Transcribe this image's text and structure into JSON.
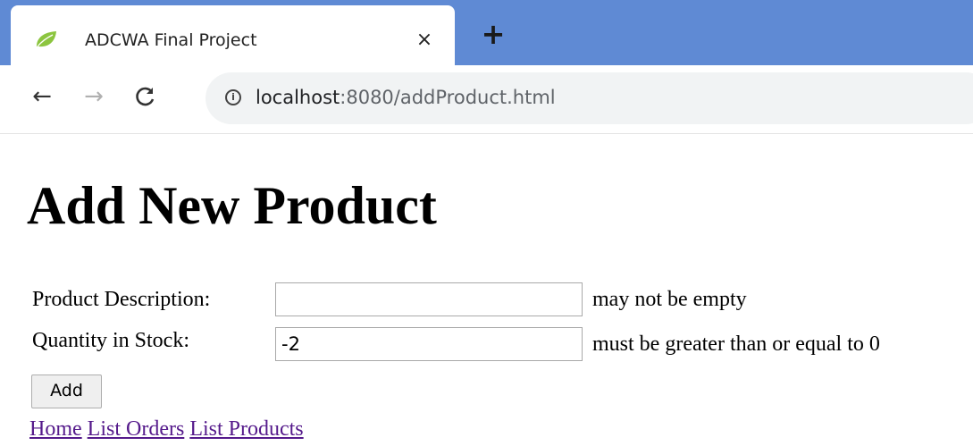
{
  "browser": {
    "tab": {
      "title": "ADCWA Final Project",
      "favicon": "spring-leaf-icon",
      "close_glyph": "×"
    },
    "new_tab_glyph": "+",
    "nav": {
      "back_glyph": "←",
      "forward_glyph": "→",
      "reload_glyph": "C"
    },
    "address": {
      "info_glyph": "i",
      "host": "localhost",
      "rest": ":8080/addProduct.html"
    },
    "colors": {
      "tabstrip": "#5f8ad4",
      "omnibox": "#f1f3f4"
    }
  },
  "page": {
    "title": "Add New Product",
    "form": {
      "description": {
        "label": "Product Description:",
        "value": "",
        "error": "may not be empty"
      },
      "quantity": {
        "label": "Quantity in Stock:",
        "value": "-2",
        "error": "must be greater than or equal to 0"
      },
      "submit_label": "Add"
    },
    "links": [
      {
        "label": "Home"
      },
      {
        "label": "List Orders"
      },
      {
        "label": "List Products"
      }
    ],
    "colors": {
      "visited_link": "#551a8b"
    }
  }
}
